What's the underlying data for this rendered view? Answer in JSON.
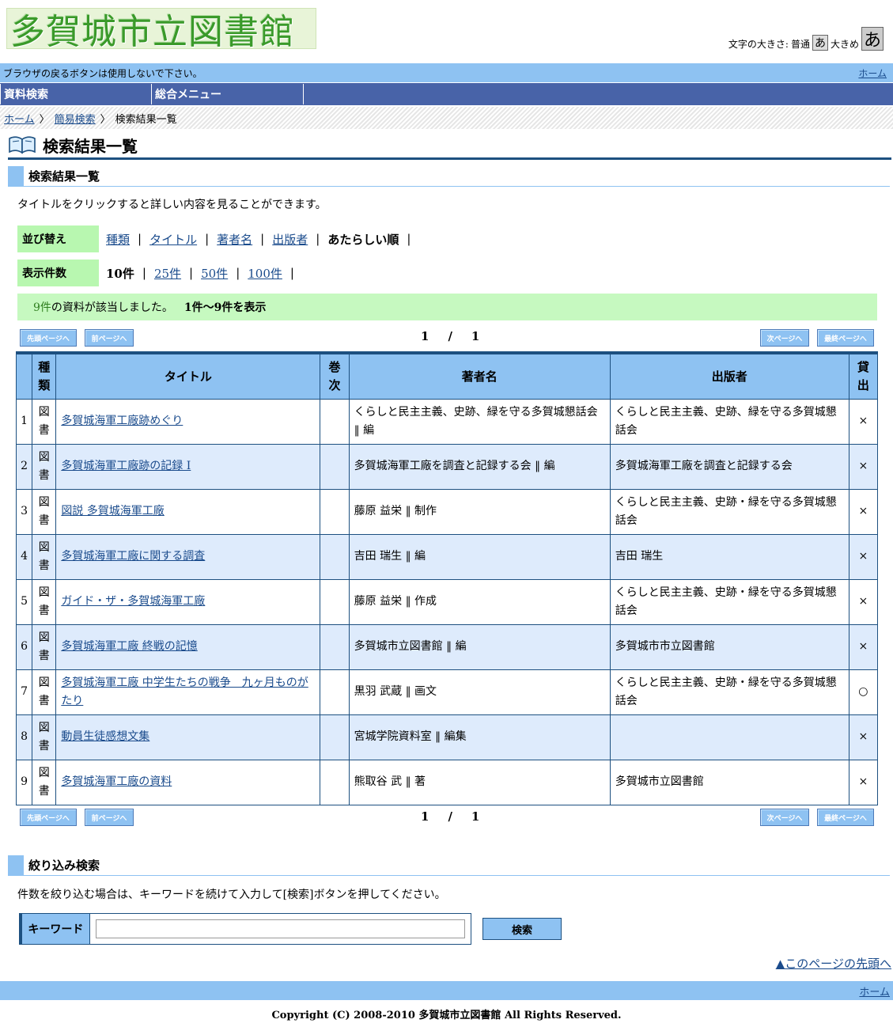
{
  "header": {
    "logo_text": "多賀城市立図書館",
    "font_size_label": "文字の大きさ:",
    "normal_label": "普通",
    "large_label": "大きめ",
    "font_glyph": "あ"
  },
  "notice": {
    "text": "ブラウザの戻るボタンは使用しないで下さい。",
    "home_link": "ホーム"
  },
  "menu": {
    "tabs": [
      "資料検索",
      "総合メニュー"
    ]
  },
  "breadcrumb": {
    "items": [
      "ホーム",
      "簡易検索",
      "検索結果一覧"
    ],
    "sep": "〉"
  },
  "page": {
    "title": "検索結果一覧",
    "section_title": "検索結果一覧",
    "instruction": "タイトルをクリックすると詳しい内容を見ることができます。"
  },
  "sort": {
    "label": "並び替え",
    "options": [
      "種類",
      "タイトル",
      "著者名",
      "出版者",
      "あたらしい順"
    ],
    "selected": "あたらしい順"
  },
  "per_page": {
    "label": "表示件数",
    "options": [
      "10件",
      "25件",
      "50件",
      "100件"
    ],
    "selected": "10件"
  },
  "hits": {
    "count": "9件",
    "suffix": "の資料が該当しました。",
    "range": "1件〜9件を表示"
  },
  "pager": {
    "first": "先頭ページへ",
    "prev": "前ページへ",
    "next": "次ページへ",
    "last": "最終ページへ",
    "current": "1",
    "slash": "/",
    "total": "1"
  },
  "table": {
    "headers": {
      "kind": "種類",
      "title": "タイトル",
      "volume": "巻次",
      "author": "著者名",
      "publisher": "出版者",
      "lend": "貸出"
    },
    "rows": [
      {
        "no": "1",
        "kind": "図書",
        "title": "多賀城海軍工廠跡めぐり",
        "volume": "",
        "author": "くらしと民主主義、史跡、緑を守る多賀城懇話会 ‖ 編",
        "publisher": "くらしと民主主義、史跡、緑を守る多賀城懇話会",
        "lend": "×"
      },
      {
        "no": "2",
        "kind": "図書",
        "title": "多賀城海軍工廠跡の記録 I",
        "volume": "",
        "author": "多賀城海軍工廠を調査と記録する会 ‖ 編",
        "publisher": "多賀城海軍工廠を調査と記録する会",
        "lend": "×"
      },
      {
        "no": "3",
        "kind": "図書",
        "title": "図説 多賀城海軍工廠",
        "volume": "",
        "author": "藤原 益栄 ‖ 制作",
        "publisher": "くらしと民主主義、史跡・緑を守る多賀城懇話会",
        "lend": "×"
      },
      {
        "no": "4",
        "kind": "図書",
        "title": "多賀城海軍工廠に関する調査",
        "volume": "",
        "author": "吉田 瑞生 ‖ 編",
        "publisher": "吉田 瑞生",
        "lend": "×"
      },
      {
        "no": "5",
        "kind": "図書",
        "title": "ガイド・ザ・多賀城海軍工廠",
        "volume": "",
        "author": "藤原 益栄 ‖ 作成",
        "publisher": "くらしと民主主義、史跡・緑を守る多賀城懇話会",
        "lend": "×"
      },
      {
        "no": "6",
        "kind": "図書",
        "title": "多賀城海軍工廠 終戦の記憶",
        "volume": "",
        "author": "多賀城市立図書館 ‖ 編",
        "publisher": "多賀城市市立図書館",
        "lend": "×"
      },
      {
        "no": "7",
        "kind": "図書",
        "title": "多賀城海軍工廠 中学生たちの戦争　九ヶ月ものがたり",
        "volume": "",
        "author": "黒羽 武蔵 ‖ 画文",
        "publisher": "くらしと民主主義、史跡・緑を守る多賀城懇話会",
        "lend": "○"
      },
      {
        "no": "8",
        "kind": "図書",
        "title": "動員生徒感想文集",
        "volume": "",
        "author": "宮城学院資料室 ‖ 編集",
        "publisher": "",
        "lend": "×"
      },
      {
        "no": "9",
        "kind": "図書",
        "title": "多賀城海軍工廠の資料",
        "volume": "",
        "author": "熊取谷 武 ‖ 著",
        "publisher": "多賀城市立図書館",
        "lend": "×"
      }
    ]
  },
  "refine": {
    "title": "絞り込み検索",
    "instruction": "件数を絞り込む場合は、キーワードを続けて入力して[検索]ボタンを押してください。",
    "keyword_label": "キーワード",
    "keyword_value": "",
    "search_button": "検索"
  },
  "footer": {
    "to_top": "▲このページの先頭へ",
    "home_link": "ホーム",
    "copyright": "Copyright (C) 2008-2010 多賀城市立図書館 All Rights Reserved."
  }
}
